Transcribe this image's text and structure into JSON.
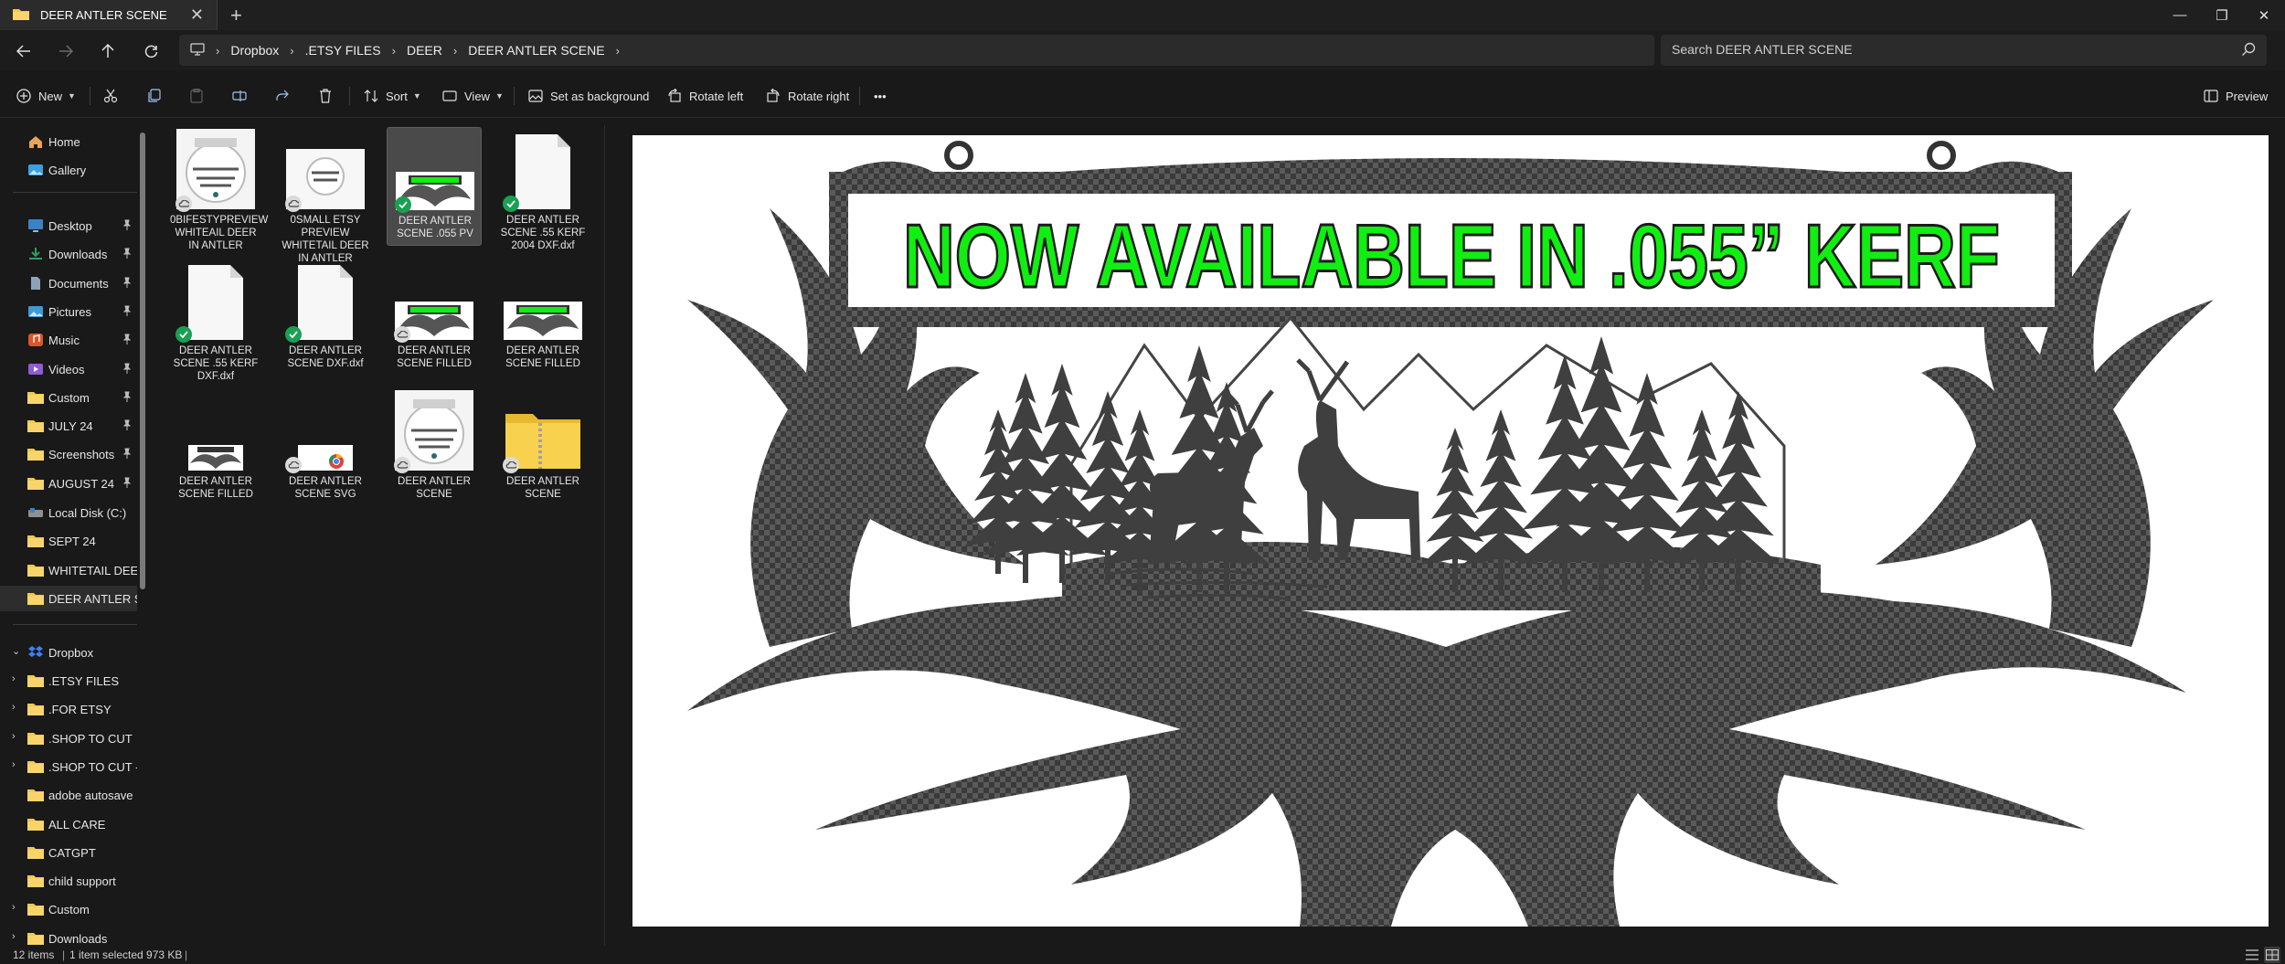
{
  "window": {
    "tab_title": "DEER ANTLER SCENE",
    "new_tab": "+",
    "close": "✕",
    "minimize": "—",
    "restore": "❐",
    "window_close": "✕"
  },
  "breadcrumb": {
    "items": [
      "Dropbox",
      ".ETSY FILES",
      "DEER",
      "DEER ANTLER SCENE"
    ]
  },
  "search": {
    "placeholder": "Search DEER ANTLER SCENE"
  },
  "toolbar": {
    "new_label": "New",
    "sort_label": "Sort",
    "view_label": "View",
    "set_background_label": "Set as background",
    "rotate_left_label": "Rotate left",
    "rotate_right_label": "Rotate right",
    "more_label": "•••",
    "preview_label": "Preview"
  },
  "nav": {
    "quick": [
      {
        "label": "Home",
        "icon": "home-icon"
      },
      {
        "label": "Gallery",
        "icon": "gallery-icon"
      }
    ],
    "pinned": [
      {
        "label": "Desktop",
        "icon": "desktop-icon",
        "color": "#3b82c4"
      },
      {
        "label": "Downloads",
        "icon": "downloads-icon",
        "color": "#2f9e5f"
      },
      {
        "label": "Documents",
        "icon": "documents-icon",
        "color": "#7a8fa6"
      },
      {
        "label": "Pictures",
        "icon": "pictures-icon",
        "color": "#3c9bd6"
      },
      {
        "label": "Music",
        "icon": "music-icon",
        "color": "#d9572c"
      },
      {
        "label": "Videos",
        "icon": "videos-icon",
        "color": "#8f5bd6"
      },
      {
        "label": "Custom",
        "icon": "folder-icon",
        "color": "#f2c94c"
      },
      {
        "label": "JULY 24",
        "icon": "folder-icon",
        "color": "#f2c94c"
      },
      {
        "label": "Screenshots",
        "icon": "folder-icon",
        "color": "#f2c94c"
      },
      {
        "label": "AUGUST 24",
        "icon": "folder-icon",
        "color": "#f2c94c"
      }
    ],
    "others": [
      {
        "label": "Local Disk (C:)",
        "icon": "drive-icon"
      },
      {
        "label": "SEPT 24",
        "icon": "folder-icon"
      },
      {
        "label": "WHITETAIL DEER SC",
        "icon": "folder-icon"
      },
      {
        "label": "DEER ANTLER SCEN",
        "icon": "folder-icon"
      }
    ],
    "dropbox": {
      "label": "Dropbox",
      "children": [
        {
          "label": ".ETSY FILES",
          "expand": true
        },
        {
          "label": ".FOR ETSY",
          "expand": true
        },
        {
          "label": ".SHOP TO CUT",
          "expand": true
        },
        {
          "label": ".SHOP TO CUT - (",
          "expand": true
        },
        {
          "label": "adobe autosave",
          "expand": false
        },
        {
          "label": "ALL CARE",
          "expand": false
        },
        {
          "label": "CATGPT",
          "expand": false
        },
        {
          "label": "child support",
          "expand": false
        },
        {
          "label": "Custom",
          "expand": true
        },
        {
          "label": "Downloads",
          "expand": true
        }
      ]
    }
  },
  "files": [
    {
      "label": "0BIFESTYPREVIEW WHITEAIL DEER IN ANTLER",
      "kind": "round-preview",
      "status": "cloud"
    },
    {
      "label": "0SMALL ETSY PREVIEW WHITETAIL DEER IN ANTLER",
      "kind": "small-preview",
      "status": "cloud"
    },
    {
      "label": "DEER ANTLER SCENE .055 PV",
      "kind": "antler-thumb",
      "status": "synced"
    },
    {
      "label": "DEER ANTLER SCENE .55 KERF 2004 DXF.dxf",
      "kind": "doc",
      "status": "synced"
    },
    {
      "label": "DEER ANTLER SCENE .55 KERF DXF.dxf",
      "kind": "doc",
      "status": "synced"
    },
    {
      "label": "DEER ANTLER SCENE DXF.dxf",
      "kind": "doc",
      "status": "synced"
    },
    {
      "label": "DEER ANTLER SCENE FILLED",
      "kind": "antler-thumb",
      "status": "cloud"
    },
    {
      "label": "DEER ANTLER SCENE FILLED",
      "kind": "antler-thumb",
      "status": "none"
    },
    {
      "label": "DEER ANTLER SCENE FILLED",
      "kind": "antler-small",
      "status": "none"
    },
    {
      "label": "DEER ANTLER SCENE SVG",
      "kind": "svg-chrome",
      "status": "cloud"
    },
    {
      "label": "DEER ANTLER SCENE",
      "kind": "round-preview",
      "status": "cloud"
    },
    {
      "label": "DEER ANTLER SCENE",
      "kind": "zip-folder",
      "status": "cloud"
    }
  ],
  "preview": {
    "banner_text": "NOW AVAILABLE IN .055” KERF",
    "banner_color": "#11ee11",
    "pattern_color": "#3a3a3a"
  },
  "status": {
    "item_count": "12 items",
    "selection": "1 item selected  973 KB",
    "sep": "|"
  }
}
